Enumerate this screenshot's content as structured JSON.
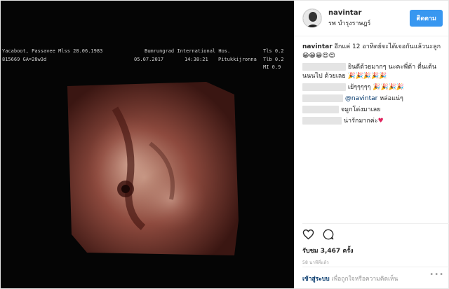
{
  "media": {
    "overlay": {
      "l1a": "Yacaboot, Passavee  Mlss 28.06.1983",
      "l1b": "Bumrungrad International Hos.",
      "l1c": "Tls 0.2",
      "l2a": "815669  GA=28w3d",
      "l2b": "05.07.2017",
      "l2c": "14:38:21",
      "l2d": "Pitukkijronna",
      "l2e": "Tlb 0.2",
      "l3a": "MI 0.9"
    }
  },
  "header": {
    "username": "navintar",
    "location": "รพ บำรุงราษฎร์",
    "follow_label": "ติดตาม"
  },
  "comments": {
    "caption_user": "navintar",
    "caption_text": " อีกแค่ 12 อาทิตย์จะได้เจอกันแล้วนะลูก",
    "caption_emoji": "😁😁😁😍😍",
    "c1_text": "ยินดีด้วยมากๆ นะคะพี่ต้า ตื่นเต้นนนนไป ด้วยเลย",
    "c1_emoji": "🎉🎉🎉🎉🎉",
    "c2_text": "เย้ๆๆๆๆๆ",
    "c2_emoji": "🎉🎉🎉🎉",
    "c3_mention": "@navintar",
    "c3_text": " หล่อแน่ๆ",
    "c4_text": "จมูกโด่งมาเลย",
    "c5_text": "น่ารักมากค่ะ",
    "c5_emoji": "♥"
  },
  "actions": {
    "likes": "รับชม 3,467 ครั้ง",
    "time": "58 นาทีที่แล้ว"
  },
  "comment_bar": {
    "login": "เข้าสู่ระบบ",
    "prompt": "เพื่อถูกใจหรือความคิดเห็น",
    "more": "•••"
  },
  "icons": [
    "heart-icon",
    "comment-icon",
    "more-options-icon"
  ],
  "colors": {
    "follow": "#3897f0",
    "link": "#003569",
    "muted": "#999999"
  }
}
